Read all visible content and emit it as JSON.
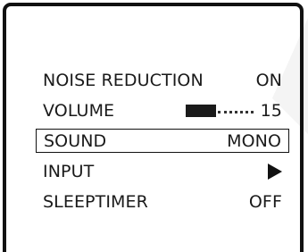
{
  "menu": {
    "items": [
      {
        "label": "NOISE REDUCTION",
        "value": "ON"
      },
      {
        "label": "VOLUME",
        "value": "15",
        "level": 0.45
      },
      {
        "label": "SOUND",
        "value": "MONO",
        "selected": true
      },
      {
        "label": "INPUT",
        "icon": "right-triangle-icon"
      },
      {
        "label": "SLEEPTIMER",
        "value": "OFF"
      }
    ]
  },
  "colors": {
    "frame": "#111111",
    "text": "#1a1a1a",
    "background": "#ffffff",
    "faded_shape": "#f4f4f4"
  }
}
